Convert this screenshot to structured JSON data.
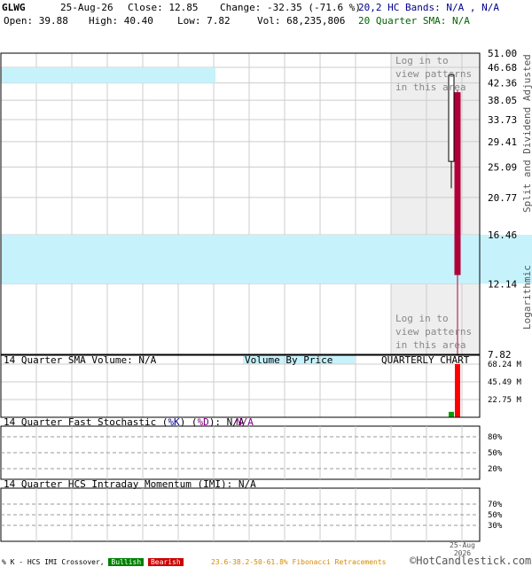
{
  "header": {
    "symbol": "GLWG",
    "date": "25-Aug-26",
    "close": "Close: 12.85",
    "change": "Change: -32.35 (-71.6 %)",
    "bands": "20,2 HC Bands: N/A , N/A",
    "open": "Open: 39.88",
    "high": "High: 40.40",
    "low": "Low: 7.82",
    "vol": "Vol: 68,235,806",
    "sma": "20 Quarter SMA: N/A"
  },
  "price_panel": {
    "login_text_top": [
      "Log in to",
      "view patterns",
      "in this area"
    ],
    "login_text_bottom": [
      "Log in to",
      "view patterns",
      "in this area"
    ],
    "right_label_top": "Split and Dividend Adjusted",
    "right_label_bottom": "Logarithmic"
  },
  "volume_panel": {
    "sma_label": "14 Quarter SMA Volume: N/A",
    "vbp_label": "Volume By Price",
    "chart_label": "QUARTERLY CHART"
  },
  "stoch_panel": {
    "label_prefix": "14 Quarter Fast Stochastic (",
    "k_label": "%K",
    "sep": ") (",
    "d_label": "%D",
    "label_suffix": "): N/A",
    "d_value": "N/A",
    "levels": [
      "80%",
      "50%",
      "20%"
    ]
  },
  "imi_panel": {
    "label": "14 Quarter HCS Intraday Momentum (IMI): N/A",
    "levels": [
      "70%",
      "50%",
      "30%"
    ]
  },
  "footer": {
    "crossover": "% K - HCS IMI Crossover,",
    "bullish": "Bullish",
    "bearish": "Bearish",
    "fib": "23.6-38.2-50-61.8% Fibonacci Retracements",
    "copyright": "©HotCandlestick.com",
    "date_top": "25-Aug",
    "date_bottom": "2026"
  },
  "colors": {
    "band_fill": "#c6f2fb",
    "shade": "#eeeeee",
    "candle_bear": "#b0003a",
    "vol_red": "#ff0000",
    "vol_green": "#00a000",
    "vbp_fill": "#c6f2fb",
    "grid": "#cccccc"
  },
  "chart_data": [
    {
      "type": "candlestick",
      "scale": "log",
      "y_ticks": [
        51.0,
        46.68,
        42.36,
        38.05,
        33.73,
        29.41,
        25.09,
        20.77,
        16.46,
        12.14,
        7.82
      ],
      "ylim": [
        7.82,
        51.0
      ],
      "x_label": "25-Aug 2026",
      "candles": [
        {
          "date": "prior quarter",
          "open": 26.0,
          "high": 45.0,
          "low": 22.0,
          "close": 44.5
        },
        {
          "date": "25-Aug-26",
          "open": 39.88,
          "high": 40.4,
          "low": 7.82,
          "close": 12.85
        }
      ],
      "volume_by_price_bands": [
        {
          "low": 12.14,
          "high": 16.46
        },
        {
          "low": 42.36,
          "high": 46.68
        }
      ]
    },
    {
      "type": "bar",
      "title": "Volume",
      "y_ticks": [
        "68.24 M",
        "45.49 M",
        "22.75 M"
      ],
      "ylim": [
        0,
        68.24
      ],
      "values": [
        {
          "date": "prior quarter",
          "value_m": 7.0,
          "direction": "up"
        },
        {
          "date": "25-Aug-26",
          "value_m": 68.24,
          "direction": "down"
        }
      ]
    }
  ]
}
